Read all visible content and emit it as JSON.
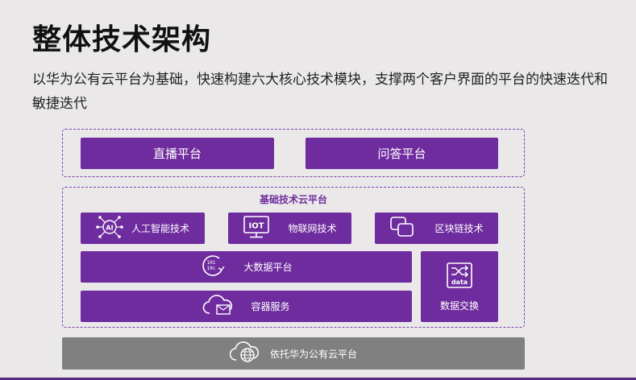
{
  "title": "整体技术架构",
  "description": "以华为公有云平台为基础，快速构建六大核心技术模块，支撑两个客户界面的平台的快速迭代和敏捷迭代",
  "top_platforms": [
    "直播平台",
    "问答平台"
  ],
  "base": {
    "title": "基础技术云平台",
    "modules": {
      "ai": "人工智能技术",
      "iot": "物联网技术",
      "blockchain": "区块链技术",
      "bigdata": "大数据平台",
      "container": "容器服务",
      "data_exchange": "数据交换"
    },
    "icons": {
      "ai": "AI",
      "iot": "IOT",
      "data": "data"
    }
  },
  "foundation": "依托华为公有云平台",
  "colors": {
    "accent": "#6f2c9e",
    "gray": "#808080"
  }
}
